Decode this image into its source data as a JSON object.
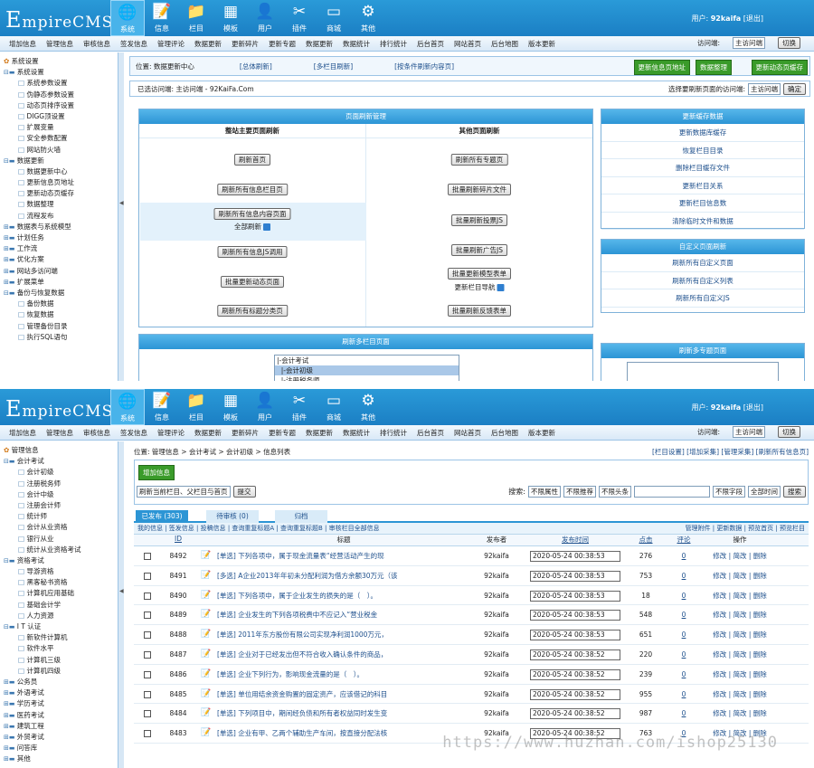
{
  "logo": {
    "big": "E",
    "rest": "mpireCMS"
  },
  "nav": [
    {
      "label": "系统",
      "icon": "🌐"
    },
    {
      "label": "信息",
      "icon": "📝"
    },
    {
      "label": "栏目",
      "icon": "📁"
    },
    {
      "label": "模板",
      "icon": "▦"
    },
    {
      "label": "用户",
      "icon": "👤"
    },
    {
      "label": "插件",
      "icon": "✂"
    },
    {
      "label": "商城",
      "icon": "▭"
    },
    {
      "label": "其他",
      "icon": "⚙"
    }
  ],
  "user": {
    "prefix": "用户:",
    "name": "92kaifa",
    "logout": "[退出]"
  },
  "subnav": [
    "增加信息",
    "管理信息",
    "审核信息",
    "签发信息",
    "管理评论",
    "数据更新",
    "更新碎片",
    "更新专题",
    "数据更新",
    "数据统计",
    "排行统计",
    "后台首页",
    "网站首页",
    "后台地图",
    "版本更新"
  ],
  "visit": {
    "label": "访问端:",
    "value": "主访问端",
    "switch": "切换"
  },
  "s1": {
    "tree": [
      {
        "t": "系统设置",
        "k": "root"
      },
      {
        "t": "系统设置",
        "k": "l1"
      },
      {
        "t": "系统参数设置",
        "k": "l2"
      },
      {
        "t": "伪静态参数设置",
        "k": "l2"
      },
      {
        "t": "动态页排序设置",
        "k": "l2"
      },
      {
        "t": "DIGG顶设置",
        "k": "l2"
      },
      {
        "t": "扩展变量",
        "k": "l2"
      },
      {
        "t": "安全参数配置",
        "k": "l2"
      },
      {
        "t": "网站防火墙",
        "k": "l2"
      },
      {
        "t": "数据更新",
        "k": "l1"
      },
      {
        "t": "数据更新中心",
        "k": "l2"
      },
      {
        "t": "更新信息页地址",
        "k": "l2"
      },
      {
        "t": "更新动态页缓存",
        "k": "l2"
      },
      {
        "t": "数据整理",
        "k": "l2"
      },
      {
        "t": "流程发布",
        "k": "l2"
      },
      {
        "t": "数据表与系统模型",
        "k": "l1 c"
      },
      {
        "t": "计划任务",
        "k": "l1 c"
      },
      {
        "t": "工作流",
        "k": "l1 c"
      },
      {
        "t": "优化方案",
        "k": "l1 c"
      },
      {
        "t": "网站多访问端",
        "k": "l1 c"
      },
      {
        "t": "扩展菜单",
        "k": "l1 c"
      },
      {
        "t": "备份与恢复数据",
        "k": "l1"
      },
      {
        "t": "备份数据",
        "k": "l2"
      },
      {
        "t": "恢复数据",
        "k": "l2"
      },
      {
        "t": "管理备份目录",
        "k": "l2"
      },
      {
        "t": "执行SQL语句",
        "k": "l2"
      }
    ],
    "location": "位置: 数据更新中心",
    "links": [
      "[总体刷新]",
      "[多栏目刷新]",
      "[按条件刷新内容页]"
    ],
    "gbtns": [
      "更新信息页地址",
      "数据整理",
      "更新动态页缓存"
    ],
    "current": "已选访问端: 主访问端 - 92KaiFa.Com",
    "pick": "选择要刷新页面的访问端:",
    "pickval": "主访问端",
    "ok": "确定",
    "p1": {
      "title": "页面刷新管理",
      "left": "整站主要页面刷新",
      "right": "其他页面刷新",
      "lbtn": [
        "刷新首页",
        "刷新所有信息栏目页",
        "刷新所有信息内容页面",
        "刷新所有信息JS调用",
        "批量更新动态页面",
        "刷新所有标题分类页"
      ],
      "whole": "全部刷新",
      "rbtn": [
        "刷新所有专题页",
        "批量刷新碎片文件",
        "批量刷新投票JS",
        "批量刷新广告JS",
        "批量更新模型表单",
        "批量刷新反馈表单"
      ],
      "navup": "更新栏目导航"
    },
    "p2": {
      "title": "更新缓存数据",
      "rows": [
        "更新数据库缓存",
        "恢复栏目目录",
        "删除栏目缓存文件",
        "更新栏目关系",
        "更新栏目信息数",
        "清除临时文件和数据"
      ]
    },
    "p3": {
      "title": "自定义页面刷新",
      "rows": [
        "刷新所有自定义页面",
        "刷新所有自定义列表",
        "刷新所有自定义JS"
      ]
    },
    "p4": {
      "title": "刷新多栏目页面",
      "items": [
        "|-会计考试",
        "  |-会计初级",
        "  |-注册税务师"
      ]
    },
    "p5": {
      "title": "刷新多专题页面"
    }
  },
  "s2": {
    "tree": [
      {
        "t": "管理信息",
        "k": "root"
      },
      {
        "t": "会计考试",
        "k": "l1"
      },
      {
        "t": "会计初级",
        "k": "l2"
      },
      {
        "t": "注册税务师",
        "k": "l2"
      },
      {
        "t": "会计中级",
        "k": "l2"
      },
      {
        "t": "注册会计师",
        "k": "l2"
      },
      {
        "t": "统计师",
        "k": "l2"
      },
      {
        "t": "会计从业资格",
        "k": "l2"
      },
      {
        "t": "银行从业",
        "k": "l2"
      },
      {
        "t": "统计从业资格考试",
        "k": "l2"
      },
      {
        "t": "资格考试",
        "k": "l1"
      },
      {
        "t": "导游资格",
        "k": "l2"
      },
      {
        "t": "黑客秘书资格",
        "k": "l2"
      },
      {
        "t": "计算机应用基础",
        "k": "l2"
      },
      {
        "t": "基础会计学",
        "k": "l2"
      },
      {
        "t": "人力资源",
        "k": "l2"
      },
      {
        "t": "I T 认证",
        "k": "l1"
      },
      {
        "t": "新软件计算机",
        "k": "l2"
      },
      {
        "t": "软件水平",
        "k": "l2"
      },
      {
        "t": "计算机三级",
        "k": "l2"
      },
      {
        "t": "计算机四级",
        "k": "l2"
      },
      {
        "t": "公务员",
        "k": "l1 c"
      },
      {
        "t": "外语考试",
        "k": "l1 c"
      },
      {
        "t": "学历考试",
        "k": "l1 c"
      },
      {
        "t": "医药考试",
        "k": "l1 c"
      },
      {
        "t": "建筑工程",
        "k": "l1 c"
      },
      {
        "t": "外贸考试",
        "k": "l1 c"
      },
      {
        "t": "问答库",
        "k": "l1 c"
      },
      {
        "t": "其他",
        "k": "l1 c"
      }
    ],
    "crumb": "位置: 管理信息 > 会计考试 > 会计初级 > 信息列表",
    "crumbLinks": "[栏目设置] [增加采集] [管理采集] [刷新所有信息页]",
    "add": "增加信息",
    "refresh": "刷新当前栏目、父栏目与首页",
    "submit": "提交",
    "search": {
      "label": "搜索:",
      "f1": "不限属性",
      "f2": "不限推荐",
      "f3": "不限头条",
      "f4": "不限字段",
      "f5": "全部时间",
      "go": "搜索"
    },
    "tabs": [
      "已发布 (303)",
      "待审核 (0)",
      "归档"
    ],
    "toolbar": "我的信息 | 签发信息 | 投稿信息 | 查询重复标题A | 查询重复标题B | 审核栏目全部信息",
    "toolbarR": "管理附件 | 更新数据 | 预览首页 | 预览栏目",
    "cols": [
      "ID",
      "标题",
      "发布者",
      "发布时间",
      "点击",
      "评论",
      "操作"
    ],
    "rows": [
      {
        "id": "8492",
        "title": "[单选] 下列各项中，属于现金流量表“经营活动产生的现",
        "user": "92kaifa",
        "time": "2020-05-24 00:38:53",
        "hits": "276",
        "cm": "0"
      },
      {
        "id": "8491",
        "title": "[多选] A企业2013年年初未分配利润为借方余额30万元（该",
        "user": "92kaifa",
        "time": "2020-05-24 00:38:53",
        "hits": "753",
        "cm": "0"
      },
      {
        "id": "8490",
        "title": "[单选] 下列各项中，属于企业发生的损失的是（　）。",
        "user": "92kaifa",
        "time": "2020-05-24 00:38:53",
        "hits": "18",
        "cm": "0"
      },
      {
        "id": "8489",
        "title": "[单选] 企业发生的下列各项税费中不应记入“营业税金",
        "user": "92kaifa",
        "time": "2020-05-24 00:38:53",
        "hits": "548",
        "cm": "0"
      },
      {
        "id": "8488",
        "title": "[单选] 2011年东方股份有限公司实现净利润1000万元，",
        "user": "92kaifa",
        "time": "2020-05-24 00:38:53",
        "hits": "651",
        "cm": "0"
      },
      {
        "id": "8487",
        "title": "[单选] 企业对于已经发出但不符合收入确认条件的商品，",
        "user": "92kaifa",
        "time": "2020-05-24 00:38:52",
        "hits": "220",
        "cm": "0"
      },
      {
        "id": "8486",
        "title": "[单选] 企业下列行为，影响现金流量的是（　）。",
        "user": "92kaifa",
        "time": "2020-05-24 00:38:52",
        "hits": "239",
        "cm": "0"
      },
      {
        "id": "8485",
        "title": "[单选] 单位用结余资金购置的固定资产，应该借记的科目",
        "user": "92kaifa",
        "time": "2020-05-24 00:38:52",
        "hits": "955",
        "cm": "0"
      },
      {
        "id": "8484",
        "title": "[单选] 下列项目中，期间经负债和所有者权益同时发生变",
        "user": "92kaifa",
        "time": "2020-05-24 00:38:52",
        "hits": "987",
        "cm": "0"
      },
      {
        "id": "8483",
        "title": "[单选] 企业有甲、乙两个辅助生产车间，按直接分配法核",
        "user": "92kaifa",
        "time": "2020-05-24 00:38:52",
        "hits": "763",
        "cm": "0"
      }
    ],
    "ops": "修改 | 简改 | 删除"
  },
  "watermark": "https://www.huzhan.com/ishop25130"
}
